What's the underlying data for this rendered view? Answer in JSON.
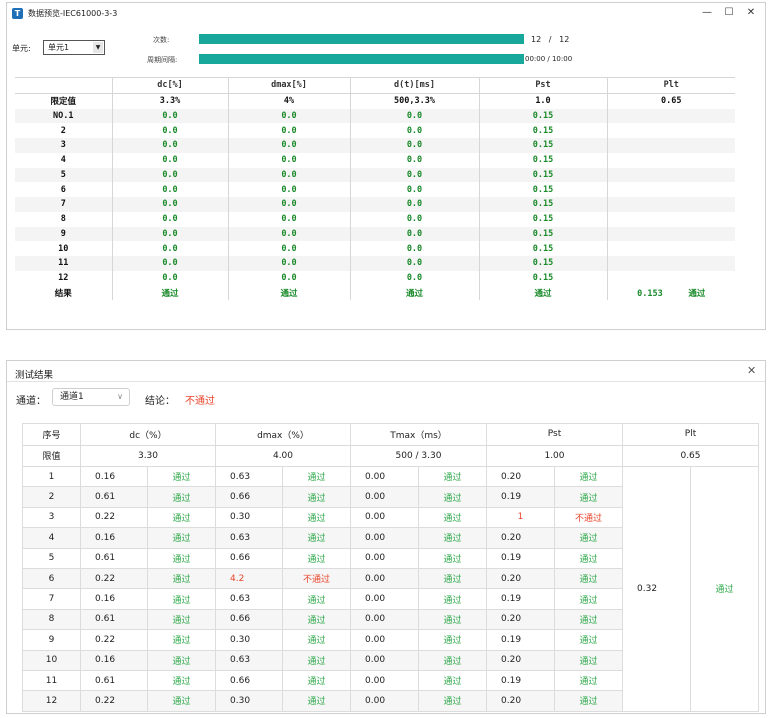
{
  "window1": {
    "title": "数据预览-IEC61000-3-3",
    "controls": {
      "minimize": "—",
      "maximize": "☐",
      "close": "✕"
    },
    "unit_label": "单元:",
    "unit_value": "单元1",
    "count_label": "次数:",
    "count_progress": 1.0,
    "count_text": "12   /   12",
    "period_label": "周期间隔:",
    "period_progress": 1.0,
    "period_text": "00:00 / 10:00",
    "table": {
      "headers": [
        "",
        "dc[%]",
        "dmax[%]",
        "d(t)[ms]",
        "Pst",
        "Plt"
      ],
      "limit_row": [
        "限定值",
        "3.3%",
        "4%",
        "500,3.3%",
        "1.0",
        "0.65"
      ],
      "rows": [
        [
          "NO.1",
          "0.0",
          "0.0",
          "0.0",
          "0.15",
          ""
        ],
        [
          "2",
          "0.0",
          "0.0",
          "0.0",
          "0.15",
          ""
        ],
        [
          "3",
          "0.0",
          "0.0",
          "0.0",
          "0.15",
          ""
        ],
        [
          "4",
          "0.0",
          "0.0",
          "0.0",
          "0.15",
          ""
        ],
        [
          "5",
          "0.0",
          "0.0",
          "0.0",
          "0.15",
          ""
        ],
        [
          "6",
          "0.0",
          "0.0",
          "0.0",
          "0.15",
          ""
        ],
        [
          "7",
          "0.0",
          "0.0",
          "0.0",
          "0.15",
          ""
        ],
        [
          "8",
          "0.0",
          "0.0",
          "0.0",
          "0.15",
          ""
        ],
        [
          "9",
          "0.0",
          "0.0",
          "0.0",
          "0.15",
          ""
        ],
        [
          "10",
          "0.0",
          "0.0",
          "0.0",
          "0.15",
          ""
        ],
        [
          "11",
          "0.0",
          "0.0",
          "0.0",
          "0.15",
          ""
        ],
        [
          "12",
          "0.0",
          "0.0",
          "0.0",
          "0.15",
          ""
        ]
      ],
      "result_row": [
        "结果",
        "通过",
        "通过",
        "通过",
        "通过",
        "0.153     通过"
      ]
    }
  },
  "window2": {
    "title": "测试结果",
    "close": "✕",
    "channel_label": "通道：",
    "channel_value": "通道1",
    "conclusion_label": "结论：",
    "conclusion_value": "不通过",
    "table": {
      "headers": [
        "序号",
        "dc（%）",
        "dmax（%）",
        "Tmax（ms）",
        "Pst",
        "Plt"
      ],
      "limit_row": [
        "限值",
        "3.30",
        "4.00",
        "500 / 3.30",
        "1.00",
        "0.65"
      ],
      "rows": [
        [
          "1",
          "0.16",
          "通过",
          "0.63",
          "通过",
          "0.00",
          "通过",
          "0.20",
          "通过"
        ],
        [
          "2",
          "0.61",
          "通过",
          "0.66",
          "通过",
          "0.00",
          "通过",
          "0.19",
          "通过"
        ],
        [
          "3",
          "0.22",
          "通过",
          "0.30",
          "通过",
          "0.00",
          "通过",
          "1",
          "不通过"
        ],
        [
          "4",
          "0.16",
          "通过",
          "0.63",
          "通过",
          "0.00",
          "通过",
          "0.20",
          "通过"
        ],
        [
          "5",
          "0.61",
          "通过",
          "0.66",
          "通过",
          "0.00",
          "通过",
          "0.19",
          "通过"
        ],
        [
          "6",
          "0.22",
          "通过",
          "4.2",
          "不通过",
          "0.00",
          "通过",
          "0.20",
          "通过"
        ],
        [
          "7",
          "0.16",
          "通过",
          "0.63",
          "通过",
          "0.00",
          "通过",
          "0.19",
          "通过"
        ],
        [
          "8",
          "0.61",
          "通过",
          "0.66",
          "通过",
          "0.00",
          "通过",
          "0.20",
          "通过"
        ],
        [
          "9",
          "0.22",
          "通过",
          "0.30",
          "通过",
          "0.00",
          "通过",
          "0.19",
          "通过"
        ],
        [
          "10",
          "0.16",
          "通过",
          "0.63",
          "通过",
          "0.00",
          "通过",
          "0.20",
          "通过"
        ],
        [
          "11",
          "0.61",
          "通过",
          "0.66",
          "通过",
          "0.00",
          "通过",
          "0.19",
          "通过"
        ],
        [
          "12",
          "0.22",
          "通过",
          "0.30",
          "通过",
          "0.00",
          "通过",
          "0.20",
          "通过"
        ]
      ],
      "plt_value": "0.32",
      "plt_result": "通过"
    }
  },
  "colors": {
    "accent": "#17a79b",
    "pass": "#2ea84a",
    "pass_dark": "#1a8a2a",
    "fail": "#e8452c"
  }
}
